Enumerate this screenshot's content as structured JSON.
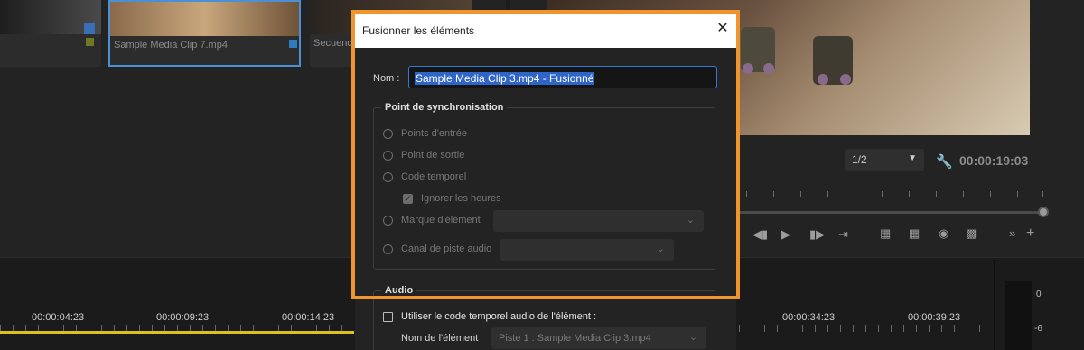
{
  "project": {
    "clips": [
      {
        "label": ""
      },
      {
        "label": "Sample Media Clip 7.mp4"
      },
      {
        "label": "Secuenc"
      }
    ]
  },
  "monitor": {
    "fraction": "1/2",
    "timecode": "00:00:19:03"
  },
  "timeline": {
    "labels": [
      "00:00:04:23",
      "00:00:09:23",
      "00:00:14:23",
      "00:00:34:23",
      "00:00:39:23"
    ],
    "meter_labels": [
      "0",
      "-6"
    ]
  },
  "dialog": {
    "title": "Fusionner les éléments",
    "name_label": "Nom :",
    "name_value": "Sample Media Clip 3.mp4 - Fusionné",
    "sync_group": "Point de synchronisation",
    "options": {
      "in_points": "Points d'entrée",
      "out_point": "Point de sortie",
      "timecode": "Code temporel",
      "ignore_hours": "Ignorer les heures",
      "clip_marker": "Marque d'élément",
      "audio_channel": "Canal de piste audio"
    },
    "audio_group": "Audio",
    "use_audio_tc": "Utiliser le code temporel audio de l'élément :",
    "clip_name_label": "Nom de l'élément",
    "clip_name_value": "Piste 1 : Sample Media Clip 3.mp4"
  },
  "colors": {
    "highlight": "#f0952e",
    "selection": "#2e65c7",
    "playhead": "#d9c21a"
  }
}
